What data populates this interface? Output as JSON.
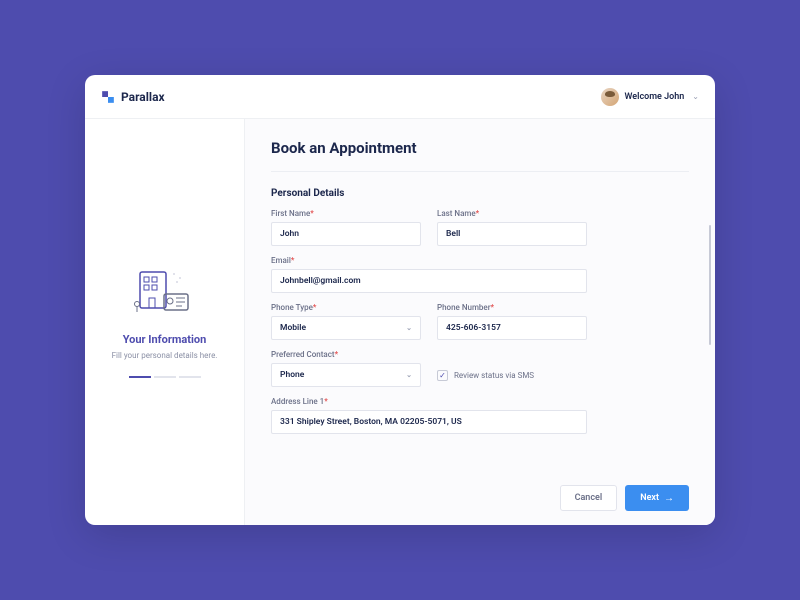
{
  "brand": {
    "name": "Parallax"
  },
  "header": {
    "welcome": "Welcome John"
  },
  "sidebar": {
    "title": "Your Information",
    "subtitle": "Fill your personal details here."
  },
  "page": {
    "title": "Book an Appointment",
    "section": "Personal Details"
  },
  "fields": {
    "first_name": {
      "label": "First Name",
      "value": "John"
    },
    "last_name": {
      "label": "Last Name",
      "value": "Bell"
    },
    "email": {
      "label": "Email",
      "value": "Johnbell@gmail.com"
    },
    "phone_type": {
      "label": "Phone Type",
      "value": "Mobile"
    },
    "phone_number": {
      "label": "Phone Number",
      "value": "425-606-3157"
    },
    "preferred_contact": {
      "label": "Preferred Contact",
      "value": "Phone"
    },
    "sms_checkbox": {
      "label": "Review status via SMS",
      "checked": true
    },
    "address1": {
      "label": "Address Line 1",
      "value": "331 Shipley Street, Boston, MA 02205-5071, US"
    }
  },
  "buttons": {
    "cancel": "Cancel",
    "next": "Next"
  }
}
